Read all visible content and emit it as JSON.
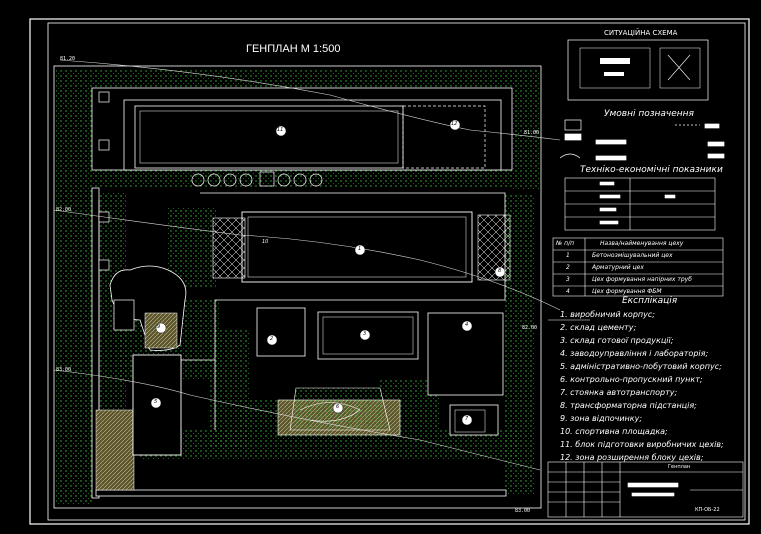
{
  "drawing": {
    "title": "ГЕНПЛАН М 1:500",
    "situation_title": "СИТУАЦІЙНА СХЕМА",
    "symbols_title": "Умовні позначення",
    "tep_title": "Техніко-економічні показники",
    "explication_title": "Експлікація",
    "table_header_num": "№ п/п",
    "table_header_name": "Назва/найменування цеху",
    "tech_rows": [
      {
        "num": "1",
        "name": "Бетонозмішувальний цех"
      },
      {
        "num": "2",
        "name": "Арматурний цех"
      },
      {
        "num": "3",
        "name": "Цех формування напірних труб"
      },
      {
        "num": "4",
        "name": "Цех формування ФБМ"
      }
    ],
    "explication": [
      "1. виробничий корпус;",
      "2. склад цементу;",
      "3. склад готової продукції;",
      "4. заводоуправління і лабораторія;",
      "5. адміністративно-побутовий корпус;",
      "6. контрольно-пропускний пункт;",
      "7. стоянка автотранспорту;",
      "8. трансформаторна підстанція;",
      "9. зона відпочинку;",
      "10. спортивна площадка;",
      "11. блок підготовки виробничих цехів;",
      "12. зона розширення блоку цехів;"
    ],
    "building_numbers": [
      "11",
      "12",
      "1",
      "2",
      "3",
      "4",
      "5",
      "6",
      "7",
      "8",
      "9",
      "10"
    ],
    "elevations": [
      "81.20",
      "81.00",
      "82.00",
      "82.00",
      "83.00",
      "83.00"
    ],
    "stamp": {
      "header": "Генплан",
      "code": "КП-ОБ-22"
    },
    "colors": {
      "background": "#000000",
      "lines": "#ffffff",
      "vegetation": "#3fbf3f",
      "hatch": "#b8b070"
    }
  }
}
